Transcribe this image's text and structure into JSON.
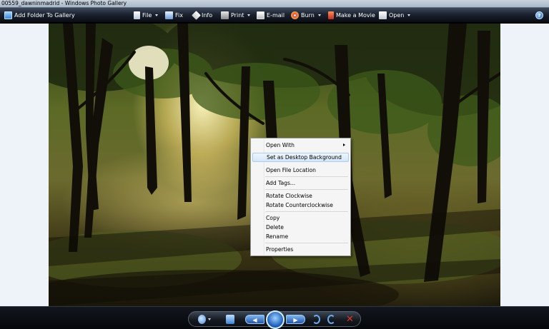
{
  "window": {
    "title": "00559_dawninmadrid - Windows Photo Gallery"
  },
  "toolbar": {
    "add_folder": {
      "label": "Add Folder To Gallery",
      "icon": "folder-add-icon"
    },
    "file": {
      "label": "File",
      "icon": "file-icon"
    },
    "fix": {
      "label": "Fix",
      "icon": "fix-icon"
    },
    "info": {
      "label": "Info",
      "icon": "tag-icon"
    },
    "print": {
      "label": "Print",
      "icon": "printer-icon"
    },
    "email": {
      "label": "E-mail",
      "icon": "email-icon"
    },
    "burn": {
      "label": "Burn",
      "icon": "disc-icon"
    },
    "movie": {
      "label": "Make a Movie",
      "icon": "movie-icon"
    },
    "open": {
      "label": "Open",
      "icon": "open-icon"
    },
    "help": {
      "glyph": "?"
    }
  },
  "context_menu": {
    "items": [
      {
        "label": "Open With",
        "submenu": true
      },
      {
        "label": "Set as Desktop Background",
        "highlighted": true
      },
      {
        "label": "Open File Location"
      },
      {
        "label": "Add Tags..."
      },
      {
        "label": "Rotate Clockwise"
      },
      {
        "label": "Rotate Counterclockwise"
      },
      {
        "label": "Copy"
      },
      {
        "label": "Delete"
      },
      {
        "label": "Rename"
      },
      {
        "label": "Properties"
      }
    ]
  },
  "controls": {
    "zoom": "zoom-icon",
    "fit": "actual-size-icon",
    "previous": "previous-icon",
    "slideshow": "slideshow-icon",
    "next": "next-icon",
    "rotate_ccw": "rotate-counterclockwise-icon",
    "rotate_cw": "rotate-clockwise-icon",
    "delete": "delete-icon"
  },
  "colors": {
    "toolbar_top": "#3e4a5c",
    "toolbar_bottom": "#090c12",
    "menu_highlight": "#d5e6f8",
    "viewer_background": "#eef3fa"
  }
}
